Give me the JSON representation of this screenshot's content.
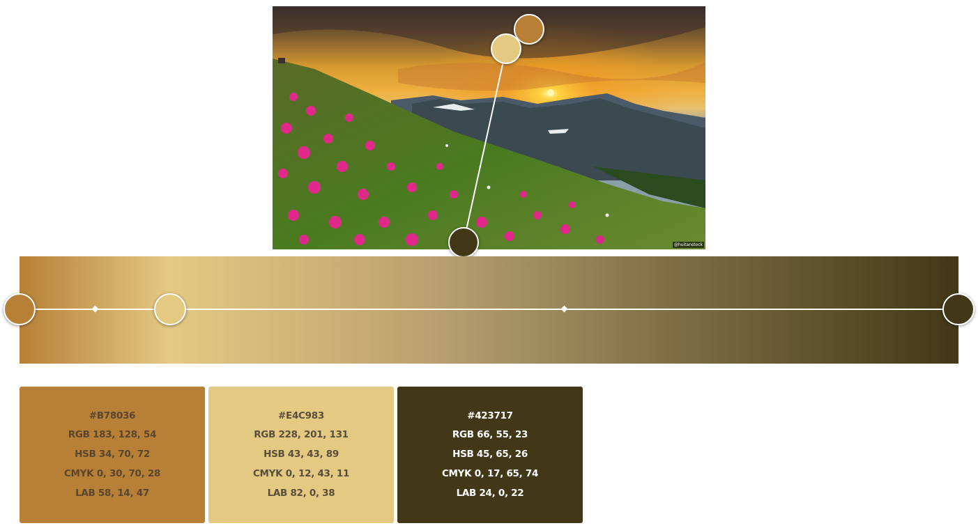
{
  "image": {
    "credit": "@huitanstock"
  },
  "gradient": {
    "stops": [
      {
        "hex": "#B78036"
      },
      {
        "hex": "#E4C983"
      },
      {
        "hex": "#423717"
      }
    ]
  },
  "swatches": [
    {
      "hex": "#B78036",
      "rgb": "RGB 183, 128, 54",
      "hsb": "HSB 34, 70, 72",
      "cmyk": "CMYK 0, 30, 70, 28",
      "lab": "LAB 58, 14, 47",
      "bg": "#B78036",
      "text_color": "#5a4630"
    },
    {
      "hex": "#E4C983",
      "rgb": "RGB 228, 201, 131",
      "hsb": "HSB 43, 43, 89",
      "cmyk": "CMYK 0, 12, 43, 11",
      "lab": "LAB 82, 0, 38",
      "bg": "#E4C983",
      "text_color": "#5a4e3a"
    },
    {
      "hex": "#423717",
      "rgb": "RGB 66, 55, 23",
      "hsb": "HSB 45, 65, 26",
      "cmyk": "CMYK 0, 17, 65, 74",
      "lab": "LAB 24, 0, 22",
      "bg": "#423717",
      "text_color": "#ffffff"
    }
  ]
}
